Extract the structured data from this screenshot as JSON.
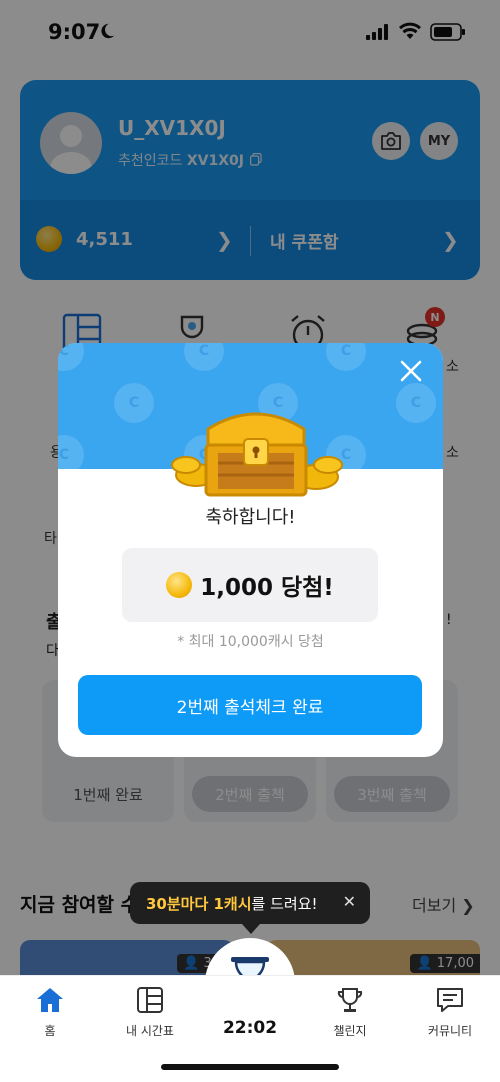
{
  "status_bar": {
    "time": "9:07"
  },
  "profile": {
    "username": "U_XV1X0J",
    "referral_label": "추천인코드",
    "referral_code": "XV1X0J",
    "my_button": "MY",
    "cash_balance": "4,511",
    "coupon_box": "내 쿠폰함"
  },
  "background_menu": {
    "partial_labels": [
      "소",
      "소",
      "용",
      "타"
    ]
  },
  "attendance": {
    "title_partial": "출",
    "sub_partial": "다",
    "right_partial": "!",
    "cards": [
      {
        "label": "1번째 완료"
      },
      {
        "label": "2번째 출첵"
      },
      {
        "label": "3번째 출첵"
      }
    ]
  },
  "challenges_section": {
    "title": "지금 참여할 수 있는 챌린지",
    "more": "더보기",
    "banner_counts": [
      "34",
      "17,00"
    ]
  },
  "tooltip": {
    "highlight": "30분마다 1캐시",
    "rest": "를 드려요!"
  },
  "tabbar": {
    "home": "홈",
    "timetable": "내 시간표",
    "timer": "22:02",
    "challenge": "챌린지",
    "community": "커뮤니티"
  },
  "modal": {
    "bg_coin_letter": "C",
    "title": "축하합니다!",
    "prize": "1,000 당첨!",
    "note": "* 최대 10,000캐시 당첨",
    "button": "2번째 출석체크 완료"
  },
  "colors": {
    "brand_blue": "#1a9cf5",
    "button_blue": "#0d9bf7",
    "coin_gold": "#f5b90b",
    "tooltip_bg": "#1f1f1f",
    "tooltip_highlight": "#ffc83d",
    "badge_red": "#e8322b"
  }
}
